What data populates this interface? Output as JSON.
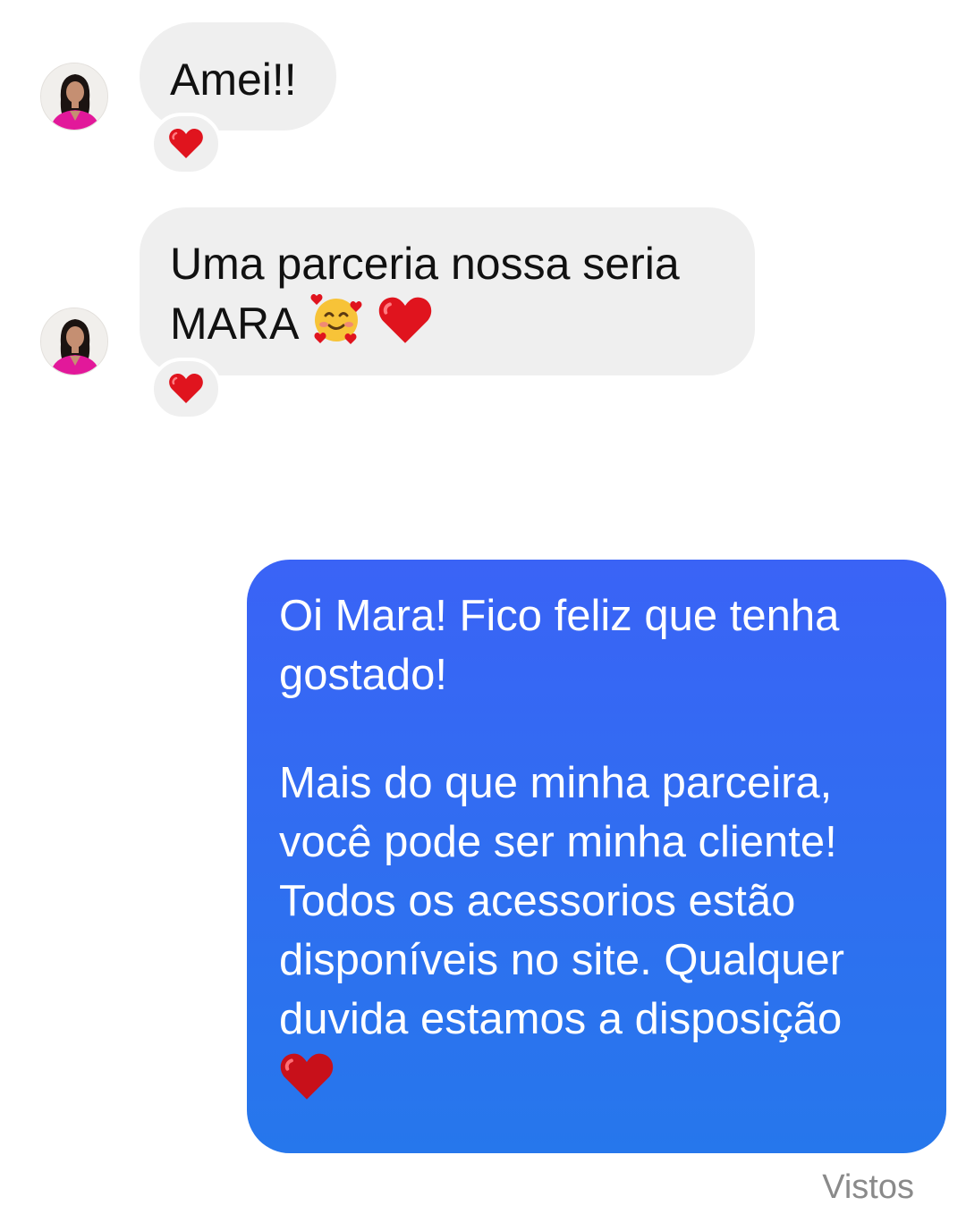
{
  "messages": [
    {
      "from": "contact",
      "lines": [
        "Amei!!"
      ],
      "reaction": "heart-icon"
    },
    {
      "from": "contact",
      "lines": [
        "Uma parceria nossa seria",
        "MARA"
      ],
      "inline_emojis": [
        "smiling-face-with-hearts-icon",
        "heart-icon"
      ],
      "reaction": "heart-icon"
    },
    {
      "from": "me",
      "paragraph_1": [
        "Oi Mara! Fico feliz que tenha",
        "gostado!"
      ],
      "paragraph_2": [
        "Mais do que minha parceira,",
        "você pode ser minha cliente!",
        "Todos os acessorios estão",
        "disponíveis no site. Qualquer",
        "duvida estamos a disposição"
      ],
      "trailing_emoji": "heart-icon"
    }
  ],
  "status": "Vistos",
  "colors": {
    "incoming_bubble": "#efefef",
    "outgoing_bubble_top": "#3a63f6",
    "outgoing_bubble_bottom": "#2677ec",
    "heart": "#e0141e",
    "status_text": "#8a8a8a"
  }
}
